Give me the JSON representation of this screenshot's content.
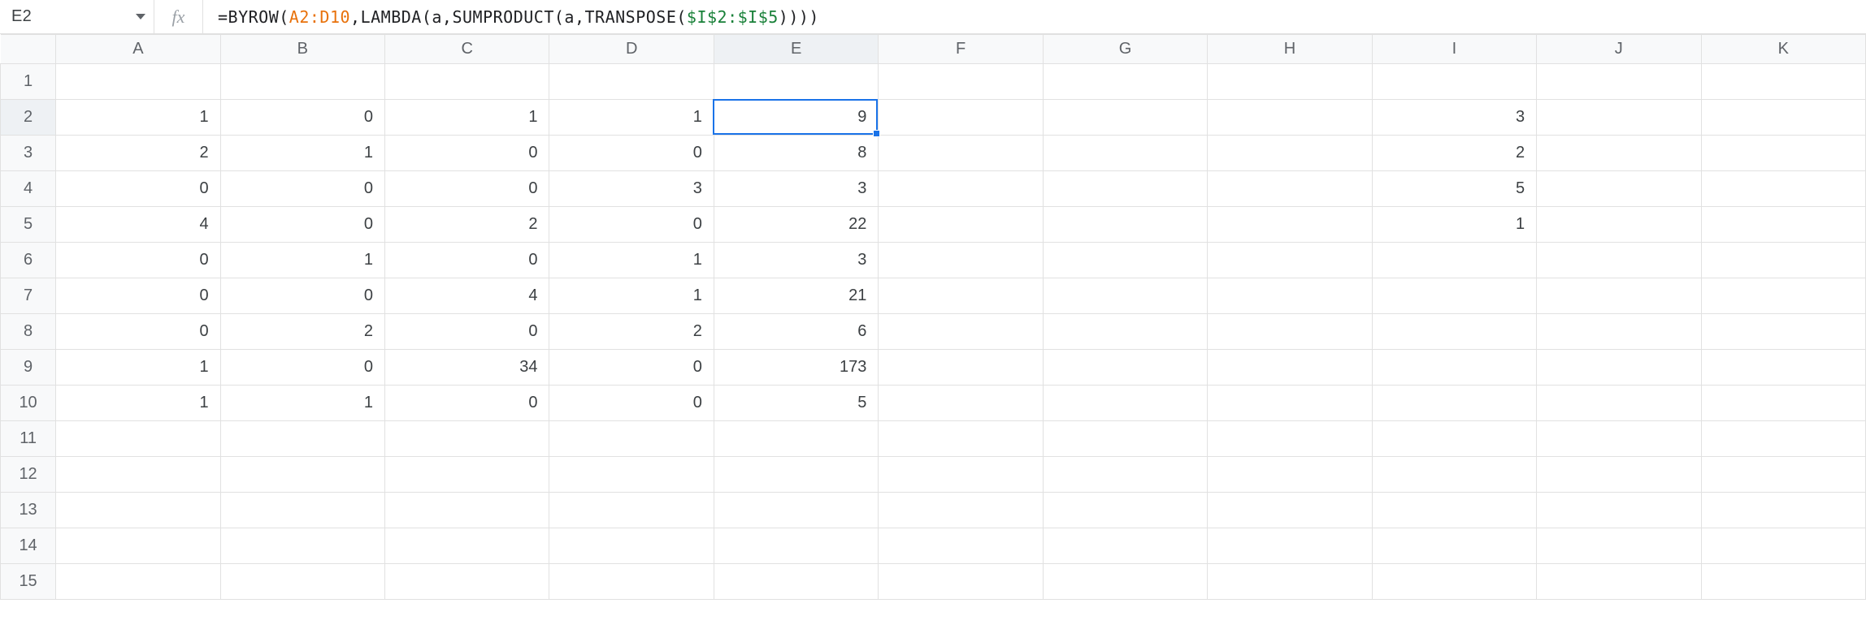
{
  "name_box": {
    "value": "E2"
  },
  "fx_label": "fx",
  "formula": {
    "segments": [
      {
        "t": "plain",
        "v": "=BYROW("
      },
      {
        "t": "orange",
        "v": "A2:D10"
      },
      {
        "t": "plain",
        "v": ",LAMBDA(a,SUMPRODUCT(a,TRANSPOSE("
      },
      {
        "t": "green",
        "v": "$I$2:$I$5"
      },
      {
        "t": "plain",
        "v": "))))"
      }
    ]
  },
  "columns": [
    "A",
    "B",
    "C",
    "D",
    "E",
    "F",
    "G",
    "H",
    "I",
    "J",
    "K"
  ],
  "row_count": 15,
  "active_cell": {
    "col": "E",
    "row": 2
  },
  "cells": {
    "A2": "1",
    "B2": "0",
    "C2": "1",
    "D2": "1",
    "E2": "9",
    "I2": "3",
    "A3": "2",
    "B3": "1",
    "C3": "0",
    "D3": "0",
    "E3": "8",
    "I3": "2",
    "A4": "0",
    "B4": "0",
    "C4": "0",
    "D4": "3",
    "E4": "3",
    "I4": "5",
    "A5": "4",
    "B5": "0",
    "C5": "2",
    "D5": "0",
    "E5": "22",
    "I5": "1",
    "A6": "0",
    "B6": "1",
    "C6": "0",
    "D6": "1",
    "E6": "3",
    "A7": "0",
    "B7": "0",
    "C7": "4",
    "D7": "1",
    "E7": "21",
    "A8": "0",
    "B8": "2",
    "C8": "0",
    "D8": "2",
    "E8": "6",
    "A9": "1",
    "B9": "0",
    "C9": "34",
    "D9": "0",
    "E9": "173",
    "A10": "1",
    "B10": "1",
    "C10": "0",
    "D10": "0",
    "E10": "5"
  }
}
